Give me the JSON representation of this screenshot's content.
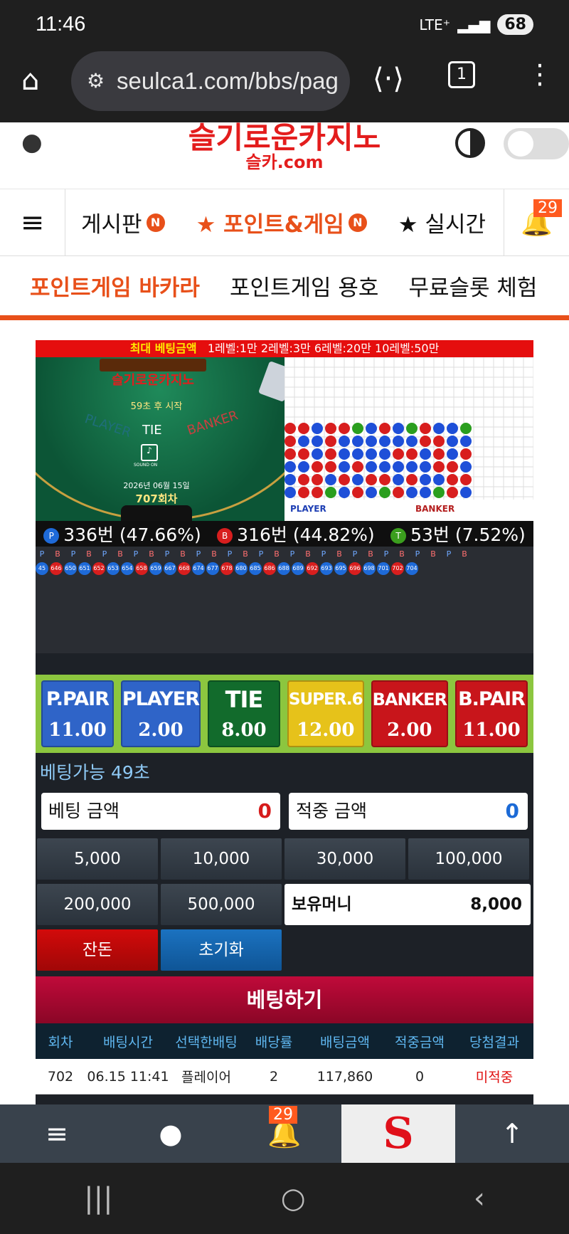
{
  "status": {
    "time": "11:46",
    "network": "LTE⁺",
    "battery": "68"
  },
  "browser": {
    "url": "seulca1.com/bbs/pag",
    "tabs_count": "1"
  },
  "site": {
    "logo_text": "슬기로운카지노",
    "logo_sub": "슬카.com"
  },
  "nav": {
    "items": [
      {
        "label": "게시판",
        "badge": "N"
      },
      {
        "label": "★ 포인트&게임",
        "badge": "N"
      },
      {
        "label": "★ 실시간",
        "badge": ""
      }
    ],
    "bell_count": "29"
  },
  "subnav": [
    "포인트게임 바카라",
    "포인트게임 용호",
    "무료슬롯 체험"
  ],
  "game": {
    "max_bet_label": "최대 베팅금액",
    "max_bet_levels": "1레벨:1만 2레벨:3만 6레벨:20만 10레벨:50만",
    "table_logo": "슬기로운카지노",
    "countdown": "59초 후 시작",
    "player_label": "PLAYER",
    "tie_label": "TIE",
    "banker_label": "BANKER",
    "sound_label": "SOUND ON",
    "date": "2026년 06월 15일",
    "round": "707회차",
    "road_legend_player": "PLAYER",
    "road_legend_banker": "BANKER",
    "stats": [
      {
        "marker": "P",
        "text": "336번 (47.66%)"
      },
      {
        "marker": "B",
        "text": "316번 (44.82%)"
      },
      {
        "marker": "T",
        "text": "53번 (7.52%)"
      }
    ],
    "history_head": [
      "P",
      "B",
      "P",
      "B",
      "P",
      "B",
      "P",
      "B",
      "P",
      "B",
      "P",
      "B",
      "P",
      "B",
      "P",
      "B",
      "P",
      "B",
      "P",
      "B",
      "P",
      "B",
      "P",
      "B",
      "P",
      "B",
      "P",
      "B"
    ],
    "history_top": [
      "45",
      "646",
      "650",
      "651",
      "652",
      "653",
      "654",
      "658",
      "659",
      "667",
      "668",
      "674",
      "677",
      "678",
      "680",
      "685",
      "686",
      "688",
      "689",
      "692",
      "693",
      "695",
      "696",
      "698",
      "701",
      "702",
      "704"
    ],
    "bets": [
      {
        "label": "P.PAIR",
        "odds": "11.00",
        "color": "#2f64c8"
      },
      {
        "label": "PLAYER",
        "odds": "2.00",
        "color": "#2f64c8"
      },
      {
        "label": "TIE",
        "odds": "8.00",
        "color": "#126b2c"
      },
      {
        "label": "SUPER.6",
        "odds": "12.00",
        "color": "#e6c21a"
      },
      {
        "label": "BANKER",
        "odds": "2.00",
        "color": "#c8151b"
      },
      {
        "label": "B.PAIR",
        "odds": "11.00",
        "color": "#c8151b"
      }
    ],
    "bet_time": "베팅가능 49초",
    "bet_amount_label": "베팅 금액",
    "bet_amount_value": "0",
    "win_amount_label": "적중 금액",
    "win_amount_value": "0",
    "chips": [
      "5,000",
      "10,000",
      "30,000",
      "100,000",
      "200,000",
      "500,000"
    ],
    "balance_label": "보유머니",
    "balance_value": "8,000",
    "change_btn": "잔돈",
    "reset_btn": "초기화",
    "bet_btn": "베팅하기",
    "table_headers": [
      "회차",
      "배팅시간",
      "선택한배팅",
      "배당률",
      "배팅금액",
      "적중금액",
      "당첨결과"
    ],
    "table_rows": [
      [
        "702",
        "06.15 11:41",
        "플레이어",
        "2",
        "117,860",
        "0",
        "미적중"
      ]
    ]
  },
  "bottom": {
    "bell_count": "29"
  }
}
